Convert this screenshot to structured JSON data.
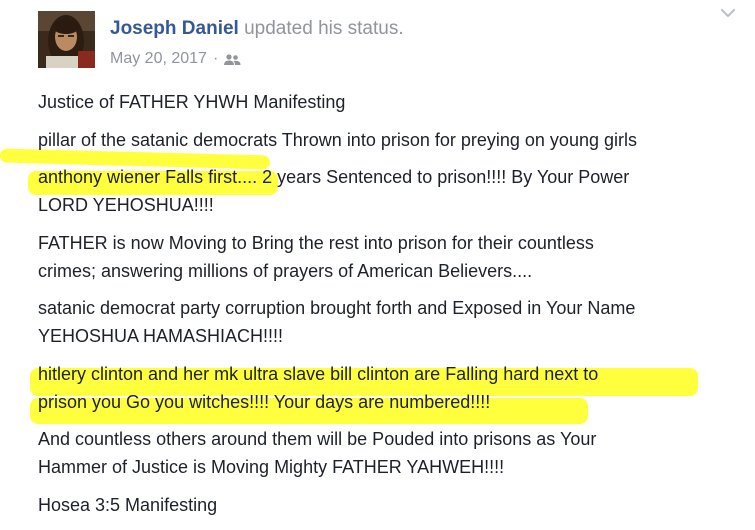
{
  "post": {
    "author": "Joseph Daniel",
    "action": "updated his status.",
    "timestamp": "May 20, 2017",
    "separator": "·",
    "audience_icon": "friends-icon",
    "menu_icon": "chevron-down-icon",
    "highlight_color": "#ffff2e",
    "name_color": "#365899",
    "paragraphs": [
      {
        "lines": [
          "Justice of FATHER YHWH Manifesting"
        ]
      },
      {
        "lines": [
          "pillar of the satanic democrats Thrown into prison for preying on young girls"
        ]
      },
      {
        "lines": [
          "anthony wiener Falls first.... 2 years Sentenced to prison!!!! By Your Power",
          "LORD YEHOSHUA!!!!"
        ]
      },
      {
        "lines": [
          "FATHER is now Moving to Bring the rest into prison for their countless",
          "crimes; answering millions of prayers of American Believers...."
        ]
      },
      {
        "lines": [
          "satanic democrat party corruption brought forth and Exposed in Your Name",
          "YEHOSHUA HAMASHIACH!!!!"
        ]
      },
      {
        "lines": [
          "hitlery clinton and her mk ultra slave bill clinton are Falling hard next to",
          "prison you Go you witches!!!! Your days are numbered!!!!"
        ]
      },
      {
        "lines": [
          "And countless others around them will be Pouded into prisons as Your",
          "Hammer of Justice is Moving Mighty FATHER YAHWEH!!!!"
        ]
      },
      {
        "lines": [
          "Hosea 3:5 Manifesting"
        ]
      }
    ]
  }
}
